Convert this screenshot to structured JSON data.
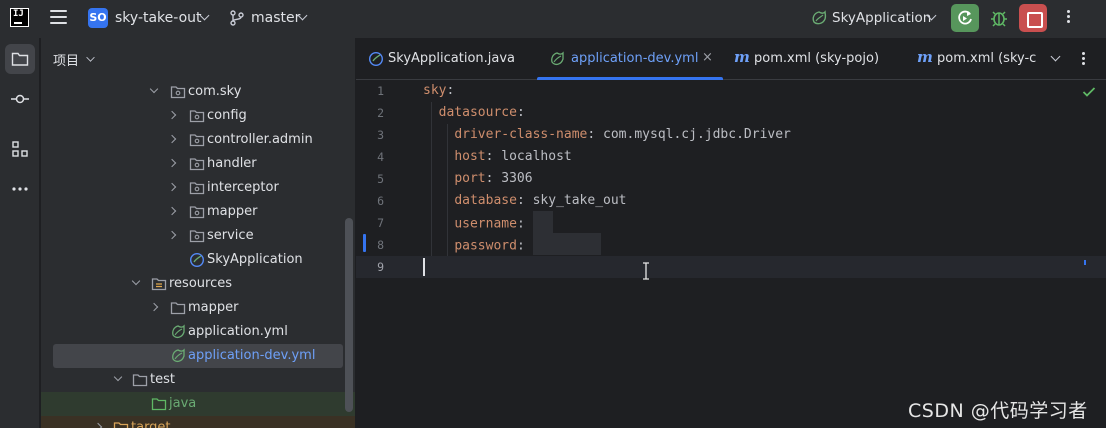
{
  "titlebar": {
    "logo_text": "IJ",
    "project_badge": "SO",
    "project_name": "sky-take-out",
    "branch": "master",
    "run_config": "SkyApplication"
  },
  "project_panel": {
    "title": "项目",
    "tree": [
      {
        "label": "com.sky",
        "type": "package",
        "expanded": true
      },
      {
        "label": "config",
        "type": "package",
        "expanded": false
      },
      {
        "label": "controller.admin",
        "type": "package",
        "expanded": false
      },
      {
        "label": "handler",
        "type": "package",
        "expanded": false
      },
      {
        "label": "interceptor",
        "type": "package",
        "expanded": false
      },
      {
        "label": "mapper",
        "type": "package",
        "expanded": false
      },
      {
        "label": "service",
        "type": "package",
        "expanded": false
      },
      {
        "label": "SkyApplication",
        "type": "spring-class"
      },
      {
        "label": "resources",
        "type": "resources-folder",
        "expanded": true
      },
      {
        "label": "mapper",
        "type": "folder",
        "expanded": false
      },
      {
        "label": "application.yml",
        "type": "yaml"
      },
      {
        "label": "application-dev.yml",
        "type": "yaml",
        "selected": true
      },
      {
        "label": "test",
        "type": "folder",
        "expanded": true
      },
      {
        "label": "java",
        "type": "test-folder"
      },
      {
        "label": "target",
        "type": "folder",
        "expanded": false
      }
    ]
  },
  "editor": {
    "tabs": [
      {
        "label": "SkyApplication.java",
        "icon": "spring-class-icon",
        "active": false
      },
      {
        "label": "application-dev.yml",
        "icon": "yaml-icon",
        "active": true,
        "closable": true,
        "close_glyph": "×"
      },
      {
        "label": "pom.xml (sky-pojo)",
        "icon": "maven-icon",
        "icon_text": "m",
        "active": false
      },
      {
        "label": "pom.xml (sky-c",
        "icon": "maven-icon",
        "icon_text": "m",
        "active": false
      }
    ],
    "lines": [
      {
        "n": "1",
        "key": "sky",
        "value": ""
      },
      {
        "n": "2",
        "key": "datasource",
        "value": ""
      },
      {
        "n": "3",
        "key": "driver-class-name",
        "value": "com.mysql.cj.jdbc.Driver"
      },
      {
        "n": "4",
        "key": "host",
        "value": "localhost"
      },
      {
        "n": "5",
        "key": "port",
        "value": "3306"
      },
      {
        "n": "6",
        "key": "database",
        "value": "sky_take_out"
      },
      {
        "n": "7",
        "key": "username",
        "value": ""
      },
      {
        "n": "8",
        "key": "password",
        "value": ""
      },
      {
        "n": "9",
        "key": "",
        "value": ""
      }
    ],
    "current_line": 9
  },
  "watermark": "CSDN @代码学习者",
  "colors": {
    "accent": "#3574f0",
    "run_green": "#57965c",
    "stop_red": "#c94f4f",
    "yaml_key": "#cf8e6d",
    "editor_bg": "#1e1f22",
    "panel_bg": "#2b2d30"
  }
}
